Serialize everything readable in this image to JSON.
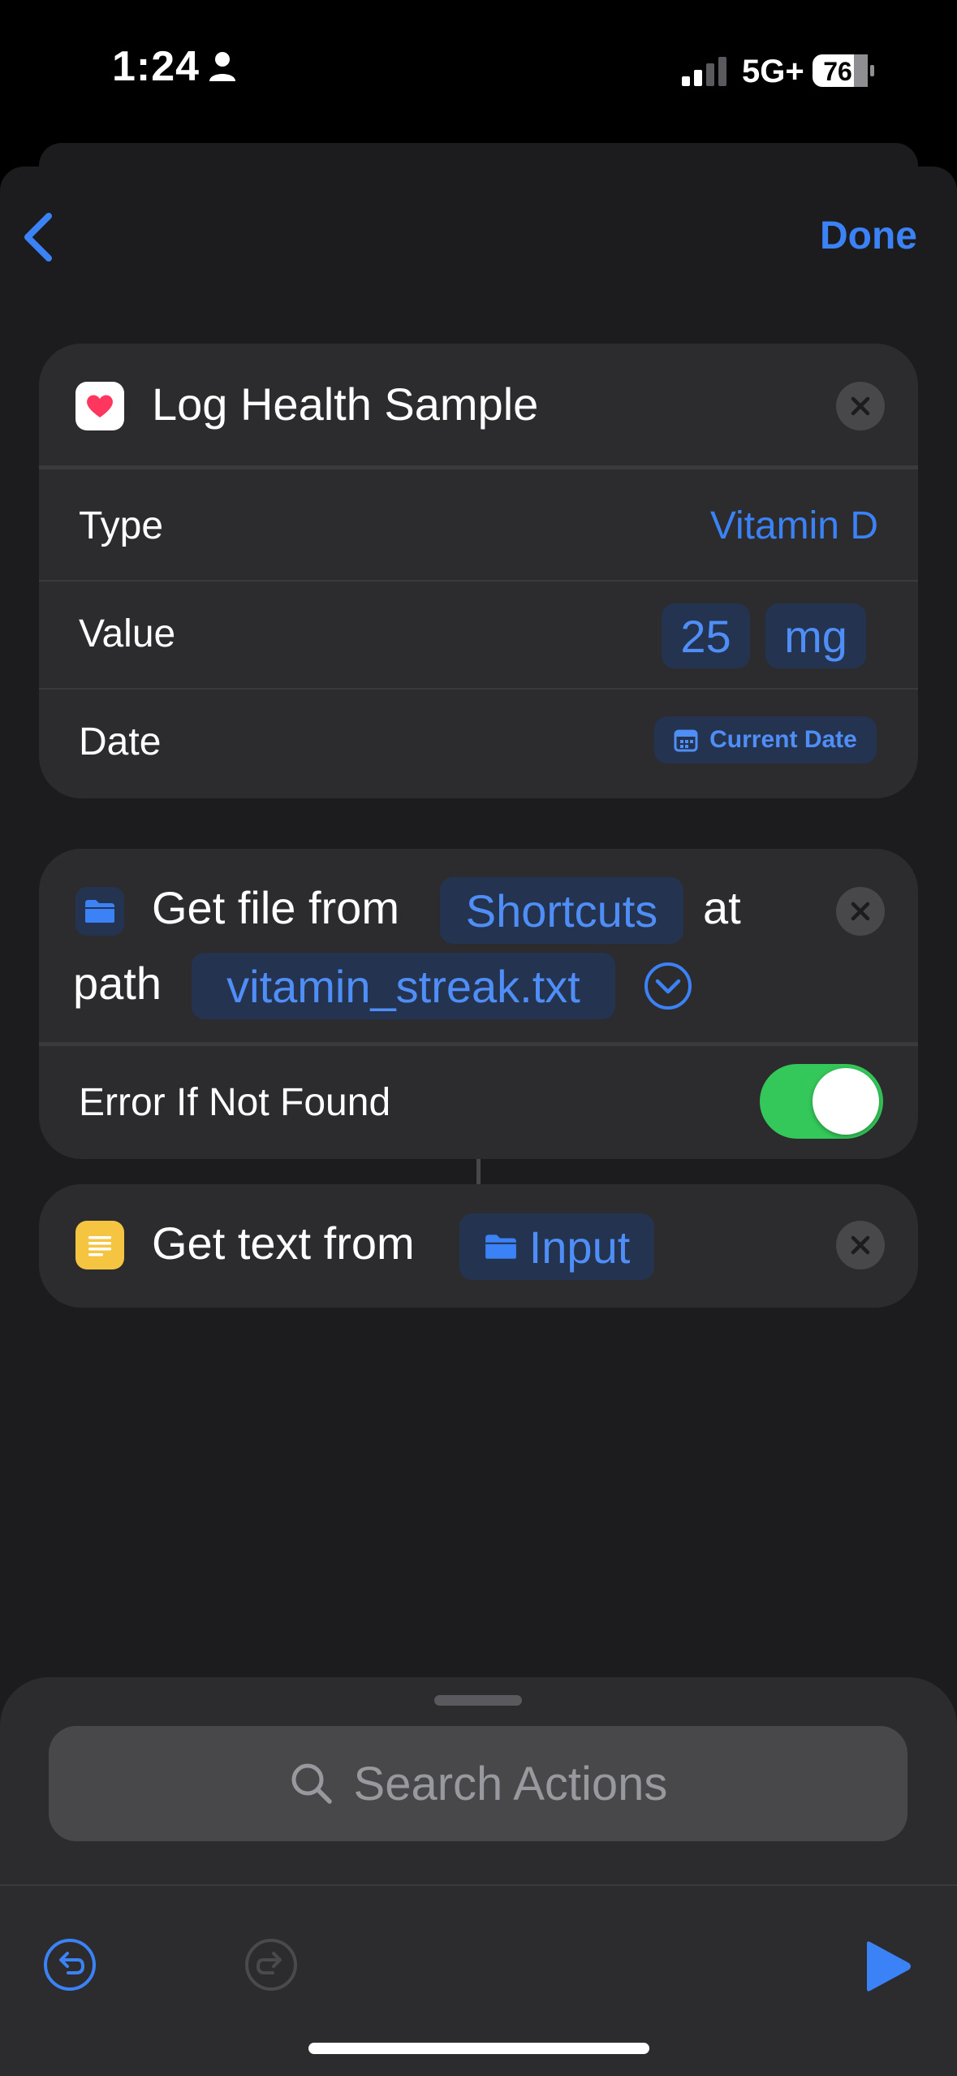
{
  "status_bar": {
    "time": "1:24",
    "network": "5G+",
    "battery": "76"
  },
  "nav": {
    "done_label": "Done"
  },
  "health_action": {
    "title": "Log Health Sample",
    "rows": [
      {
        "label": "Type",
        "value": "Vitamin D"
      },
      {
        "label": "Value",
        "value": "25",
        "unit": "mg"
      },
      {
        "label": "Date",
        "value": "Current Date"
      }
    ]
  },
  "file_action": {
    "text_get": "Get file from",
    "service": "Shortcuts",
    "text_at": "at",
    "text_path": "path",
    "path_value": "vitamin_streak.txt",
    "option_label": "Error If Not Found",
    "option_enabled": true
  },
  "text_action": {
    "text": "Get text from",
    "input_label": "Input"
  },
  "search": {
    "placeholder": "Search Actions"
  },
  "colors": {
    "accent": "#3b82f6",
    "toggle_on": "#34c759",
    "health": "#ff375f",
    "folder": "#3b82f6",
    "text_icon": "#f5c542"
  }
}
